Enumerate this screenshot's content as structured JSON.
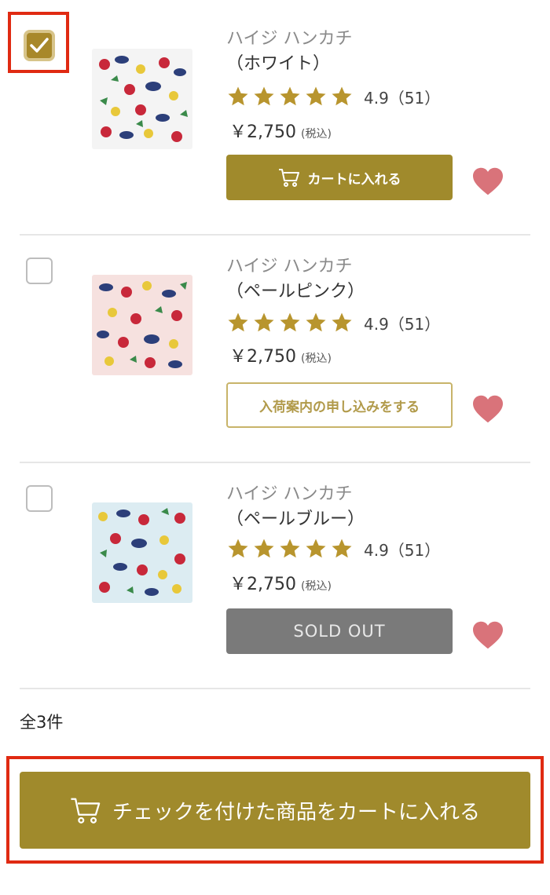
{
  "list": {
    "items": [
      {
        "name": "ハイジ ハンカチ",
        "color": "（ホワイト）",
        "checked": true,
        "rating": "4.9（51）",
        "price": "￥2,750",
        "tax": "(税込)",
        "button": {
          "type": "cart",
          "label": "カートに入れる",
          "icon": "cart-icon"
        },
        "thumb_bg": "#f4f4f4"
      },
      {
        "name": "ハイジ ハンカチ",
        "color": "（ペールピンク）",
        "checked": false,
        "rating": "4.9（51）",
        "price": "￥2,750",
        "tax": "(税込)",
        "button": {
          "type": "notify",
          "label": "入荷案内の申し込みをする"
        },
        "thumb_bg": "#f6e1df"
      },
      {
        "name": "ハイジ ハンカチ",
        "color": "（ペールブルー）",
        "checked": false,
        "rating": "4.9（51）",
        "price": "￥2,750",
        "tax": "(税込)",
        "button": {
          "type": "soldout",
          "label": "SOLD OUT"
        },
        "thumb_bg": "#dcecf2"
      }
    ],
    "rating_value": 4.9,
    "stars_filled": 5,
    "star_color": "#b8952e",
    "heart_color": "#d9737a"
  },
  "total": "全3件",
  "bulk_button": {
    "label": "チェックを付けた商品をカートに入れる",
    "icon": "cart-icon"
  },
  "colors": {
    "accent": "#a08a2c",
    "highlight": "#e02a12",
    "soldout": "#7a7a7a"
  }
}
